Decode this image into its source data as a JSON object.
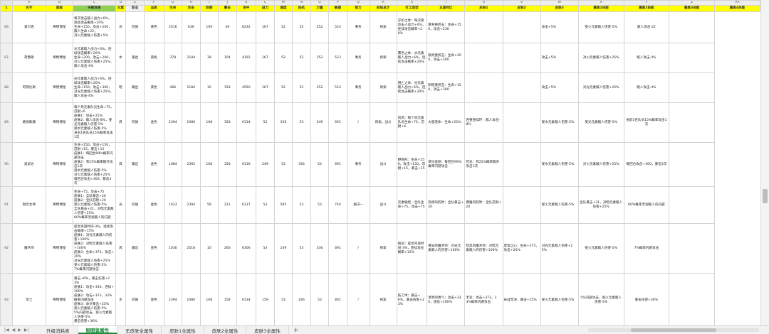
{
  "sheet": {
    "column_letters": [
      "A",
      "B",
      "C",
      "D",
      "E",
      "F",
      "G",
      "H",
      "I",
      "J",
      "K",
      "L",
      "M",
      "N",
      "O",
      "P",
      "Q",
      "R",
      "S",
      "T",
      "U",
      "V",
      "W",
      "X",
      "Y",
      "Z",
      "AA"
    ],
    "headers": [
      "名字",
      "星级",
      "天赋效果",
      "元素",
      "职业",
      "品质",
      "生命",
      "攻击",
      "防御",
      "暴击",
      "命中",
      "战力",
      "速度",
      "抵抗",
      "力量",
      "敏捷",
      "智力",
      "初始总计",
      "打工类型",
      "五星阿比",
      "皮肤1",
      "皮肤2",
      "皮肤3",
      "最高1技能",
      "最高2技能",
      "最高3技能",
      "最高4技能"
    ],
    "rows": [
      {
        "num": "86",
        "cells": [
          "素贝克",
          "稀物博星",
          "每次攻击敌人战力+6%，连续攻击概率+20%\n生命+150，攻击+200，敌人生命+22；\n对火元素敌人伤害+5%",
          "光",
          "同质",
          "黄色",
          "2016",
          "636",
          "109",
          "49",
          "6232",
          "167",
          "52",
          "52",
          "252",
          "523",
          "事务",
          "探索",
          "守护之体：每次受攻击人战力+6%，连续攻击概率+20%",
          "厚骨重折击：生命+150，攻击+230",
          "",
          "",
          "攻击+5%",
          "受火元素敌人伤害-5%",
          "敌人攻击-22",
          ""
        ]
      },
      {
        "num": "87",
        "cells": [
          "荷鲁斯",
          "稀物博星",
          "水元素敌人战力+6%，连续攻击概率+20%\n生命+200，攻击+200，对火元素敌人伤害+25%，敌人攻击-4%",
          "水",
          "输出",
          "黄色",
          "378",
          "2184",
          "39",
          "104",
          "4192",
          "167",
          "52",
          "52",
          "252",
          "523",
          "事务",
          "探索",
          "雾色之体：水元素敌人战力+6%，连续攻击概率+20%",
          "吸附重折击：生命+200，攻击+200",
          "",
          "",
          "攻击+5%",
          "对火元素敌人伤害+25%",
          "敌人攻击-4%",
          ""
        ]
      },
      {
        "num": "88",
        "cells": [
          "阿努比斯",
          "稀物博星",
          "光元素敌人战力+6%，连续攻击概率+20%\n生命+150，攻击+300，对光元素敌人伤害+25%，敌人攻击-4%",
          "暗",
          "输出",
          "黄色",
          "486",
          "2184",
          "10",
          "158",
          "4550",
          "167",
          "52",
          "52",
          "252",
          "523",
          "事务",
          "探索",
          "阴亡之体：光元素敌人战力+6%，连续攻击概率+20%",
          "阴暗重折击：生命+150，攻击+300",
          "",
          "",
          "攻击+5%",
          "对光元素敌人伤害+25%",
          "敌人攻击-4%",
          ""
        ]
      },
      {
        "num": "89",
        "cells": [
          "路易斯藤",
          "稀物博星",
          "每个风元素队员生命+75，忍耐+6\n皮肤1：攻击+25%\n皮肤2：敌人攻击-8%，受光元素敌人伤害-5%\n受水元素敌人伤害-5%\n身前1名队员15%概率攻击1次",
          "风",
          "同质",
          "金色",
          "2394",
          "1080",
          "108",
          "158",
          "6134",
          "53",
          "336",
          "53",
          "249",
          "691",
          "/",
          "探索，战斗",
          "风风：每个风元素队员生命+75，忍耐+6",
          "大丽连体：生命+25%",
          "连婆连续环：敌人攻击-8%",
          "",
          "受水元素敌人伤害-5%",
          "受光元素敌人伤害-5%",
          "身前1名队员15%概率攻击1次",
          ""
        ]
      },
      {
        "num": "90",
        "cells": [
          "奥星达",
          "稀物博星",
          "生命+150，攻击+150，忍耐+15，暴击+15\n皮肤1：每回合99%概率闪避攻击\n皮肤2：有25%概率额外攻击1次\n受水元素敌人伤害-5%\n对火元素敌人伤害+25%\n每回合攻击+300，暴击3次",
          "风",
          "输出",
          "金色",
          "1084",
          "2392",
          "108",
          "158",
          "6136",
          "249",
          "53",
          "336",
          "53",
          "691",
          "事务",
          "战斗",
          "野兽形：生命+150，攻击+150，忍耐+15，暴击+15",
          "草纹金刚：每回合99%概率闪避攻击",
          "苍龙：有25%概率额外攻击1次",
          "",
          "受水元素敌人伤害-5%",
          "对火元素敌人伤害+25%",
          "每回合攻击+300，暴击3次",
          ""
        ]
      },
      {
        "num": "91",
        "cells": [
          "锐灵女神",
          "稀物博星",
          "生命+75，攻击+75\n皮肤1：全队暴击+20\n皮肤2：全队忍耐+20\n受火元素敌人伤害-5%\n全队暴击+21，对暗元素敌人伤害+25%\n60%概率无视敌人的闪避",
          "光",
          "同质",
          "金色",
          "1033",
          "2394",
          "59",
          "212",
          "6137",
          "53",
          "585",
          "53",
          "53",
          "744",
          "植守~",
          "战斗",
          "元素联结：全队生命+75，攻击+75",
          "热情的韵吹：全队暴击+20",
          "典雅的韵吹：全队忍耐+20",
          "",
          "受火元素敌人伤害-5%",
          "全队暴击+21，对暗元素敌人伤害+25%",
          "60%概率无视敌人的闪避",
          ""
        ]
      },
      {
        "num": "92",
        "cells": [
          "魔术师",
          "稀物博星",
          "提高弯道时间-3%，连续攻击概率+15%\n皮肤1：对光元素敌人的伤害+100%\n皮肤2：对暗元素敌人伤害+100%\n皮肤3：生命+375，攻击+20%\n对光元素敌人伤害+25%\n受火元素敌人伤害-5%\n7%概率闪避攻击",
          "风",
          "输出",
          "金色",
          "1030",
          "2518",
          "10",
          "266",
          "6306",
          "53",
          "249",
          "53",
          "336",
          "691",
          "/",
          "探索",
          "挑逗：提高弯道时间-3%，连续攻击概率+15%",
          "奇异的魔术师：对光元素敌人的伤害+100%",
          "暗黑的魔术师：对暗元素敌人的伤害+100%",
          "废墟之心：生命+375，攻击+20%",
          "对光元素敌人伤害+25%",
          "受火元素敌人伤害-5%",
          "7%概率闪避攻击",
          ""
        ]
      },
      {
        "num": "93",
        "cells": [
          "贤士",
          "稀物博星",
          "暴击+6%，暴击伤害+23%\n皮肤1：攻击+330，连续+100%\n皮肤2：攻击+373，33%概率闪避攻击\n皮肤3：命令暴击+25%\n受火元素敌人伤害-5%\n5%闪避攻击，受火元素敌人伤害-5%\n暴击伤害+36%",
          "水",
          "同质",
          "金色",
          "2394",
          "1080",
          "108",
          "158",
          "6134",
          "159",
          "53",
          "336",
          "53",
          "801",
          "/",
          "探索",
          "技刀术：暴击+6%，暴击伤害+23%",
          "草原的勇气：攻击+330，连续+100%",
          "无双：攻击+373，33%概率闪避攻击",
          "命战无涛：暴击+25%",
          "受火元素敌人伤害-5%",
          "5%闪避攻击，受火元素敌人伤害-5%",
          "暴击伤害+36%",
          ""
        ]
      }
    ]
  },
  "tabs": [
    {
      "label": "升级消耗表",
      "active": false
    },
    {
      "label": "御图鉴属性",
      "active": true
    },
    {
      "label": "无皮肤全属性",
      "active": false
    },
    {
      "label": "皮肤1全属性",
      "active": false
    },
    {
      "label": "皮肤2全属性",
      "active": false
    },
    {
      "label": "皮肤3全属性",
      "active": false
    }
  ],
  "tabbar": {
    "add_label": "+",
    "nav_first": "|◀",
    "nav_prev": "◀",
    "nav_next": "▶",
    "nav_last": "▶|"
  }
}
